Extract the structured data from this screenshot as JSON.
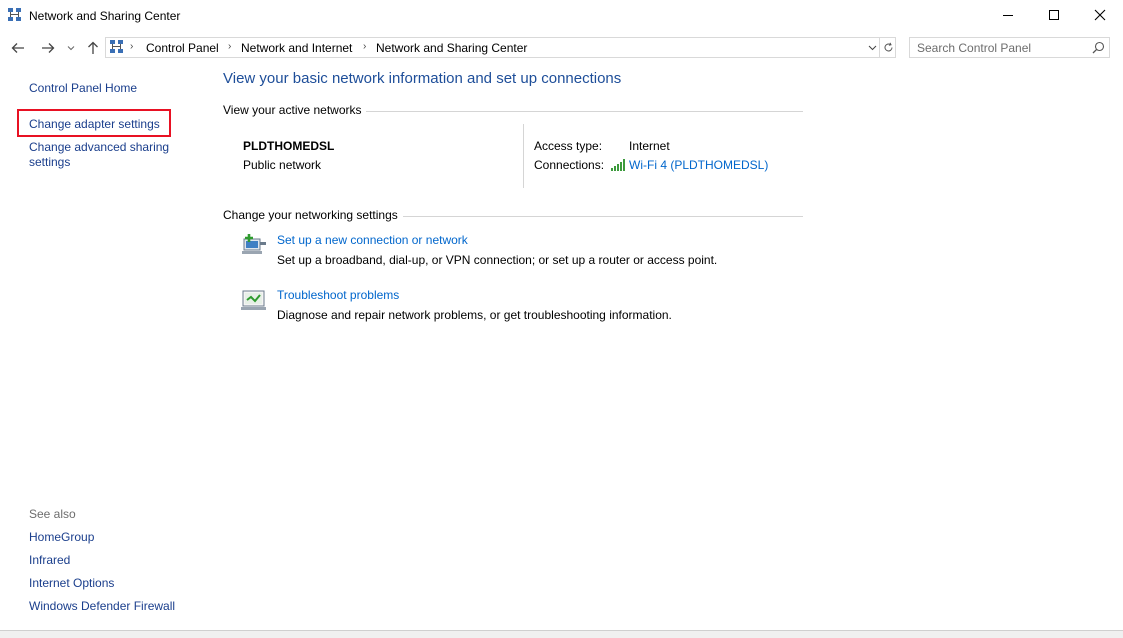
{
  "window": {
    "title": "Network and Sharing Center",
    "minimize_glyph": "—",
    "maximize_glyph": "☐",
    "close_glyph": "✕"
  },
  "nav": {
    "back": "←",
    "forward": "→",
    "recent": "⌄",
    "up": "↑",
    "breadcrumbs": [
      "Control Panel",
      "Network and Internet",
      "Network and Sharing Center"
    ],
    "refresh": "↻"
  },
  "search": {
    "placeholder": "Search Control Panel"
  },
  "sidebar": {
    "home": "Control Panel Home",
    "change_adapter": "Change adapter settings",
    "change_advanced_line1": "Change advanced sharing",
    "change_advanced_line2": "settings",
    "see_also_heading": "See also",
    "see_also": [
      "HomeGroup",
      "Infrared",
      "Internet Options",
      "Windows Defender Firewall"
    ]
  },
  "main": {
    "title": "View your basic network information and set up connections",
    "active_networks_heading": "View your active networks",
    "network_name": "PLDTHOMEDSL",
    "network_type": "Public network",
    "access_type_label": "Access type:",
    "access_type_value": "Internet",
    "connections_label": "Connections:",
    "connections_value": "Wi-Fi 4 (PLDTHOMEDSL)",
    "change_settings_heading": "Change your networking settings",
    "tasks": [
      {
        "title": "Set up a new connection or network",
        "desc": "Set up a broadband, dial-up, or VPN connection; or set up a router or access point."
      },
      {
        "title": "Troubleshoot problems",
        "desc": "Diagnose and repair network problems, or get troubleshooting information."
      }
    ]
  },
  "colors": {
    "link": "#0066cc",
    "title_blue": "#1e4e99",
    "highlight_box": "#e81123",
    "wifi_green": "#3c9a3c"
  }
}
